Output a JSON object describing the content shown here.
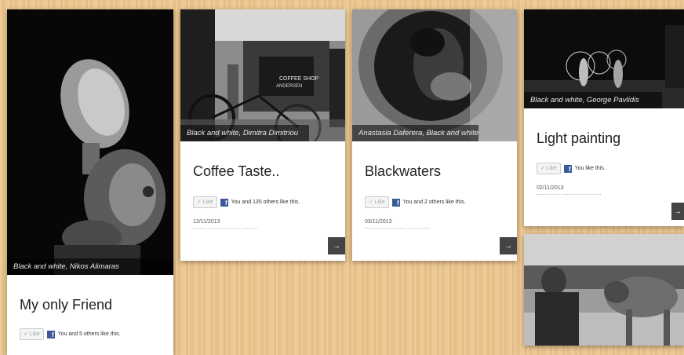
{
  "cards": [
    {
      "title": "My only Friend",
      "caption": "Black and white, Nikos Alimaras",
      "like_label": "✓ Like",
      "like_text": "You and 5 others like this."
    },
    {
      "title": "Coffee Taste..",
      "caption": "Black and white, Dimitra Dimitriou",
      "like_label": "✓ Like",
      "like_text": "You and 135 others like this.",
      "date": "12/11/2013",
      "sign_text": "COFFEE SHOP",
      "sign_text2": "ANDERSEN"
    },
    {
      "title": "Blackwaters",
      "caption": "Anastasia Daferera, Black and white",
      "like_label": "✓ Like",
      "like_text": "You and 2 others like this.",
      "date": "03/11/2013"
    },
    {
      "title": "Light painting",
      "caption": "Black and white, George Pavlidis",
      "like_label": "✓ Like",
      "like_text": "You like this.",
      "date": "02/11/2013"
    }
  ],
  "arrow_glyph": "→",
  "fb_glyph": "f"
}
